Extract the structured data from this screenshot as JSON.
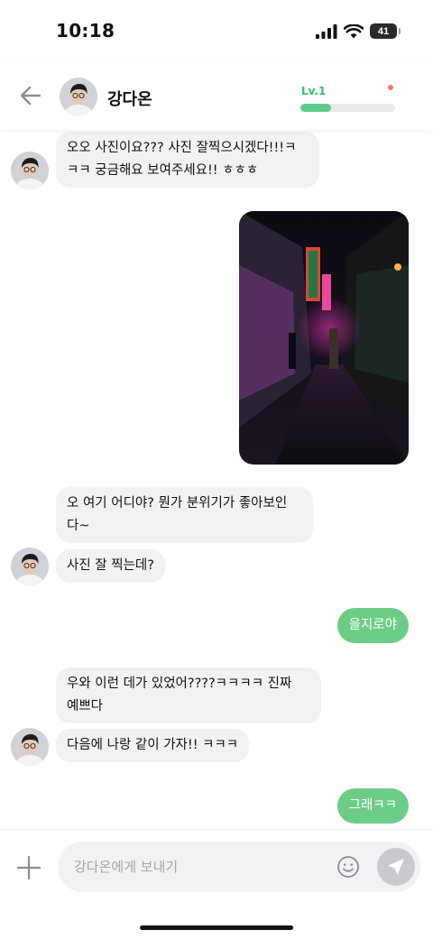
{
  "status_bar": {
    "time": "10:18",
    "battery": "41"
  },
  "header": {
    "back_icon": "arrow-left-icon",
    "name": "강다온",
    "level_label": "Lv.1",
    "level_progress": 0.32,
    "accent_color": "#5ecb8c",
    "dot_color": "#ef7b63"
  },
  "messages": [
    {
      "from": "other",
      "text": "오오 사진이요??? 사진 잘찍으시겠다!!!ㅋ\nㅋㅋ 궁금해요 보여주세요!! ㅎㅎㅎ"
    },
    {
      "from": "me",
      "type": "photo",
      "icon": "photo-alley-night-image"
    },
    {
      "from": "other",
      "text": "오 여기 어디야? 뭔가 분위기가 좋아보인\n다~"
    },
    {
      "from": "other",
      "text": "사진 잘 찍는데?"
    },
    {
      "from": "me",
      "text": "을지로야"
    },
    {
      "from": "other",
      "text": "우와 이런 데가 있었어????ㅋㅋㅋㅋ 진짜\n예쁘다"
    },
    {
      "from": "other",
      "text": "다음에 나랑 같이 가자!! ㅋㅋㅋ"
    },
    {
      "from": "me",
      "text": "그래ㅋㅋ"
    }
  ],
  "composer": {
    "placeholder": "강다온에게 보내기",
    "value": "",
    "plus_icon": "plus-icon",
    "emoji_icon": "smiley-icon",
    "send_icon": "send-icon",
    "send_color": "#c7cacf"
  }
}
